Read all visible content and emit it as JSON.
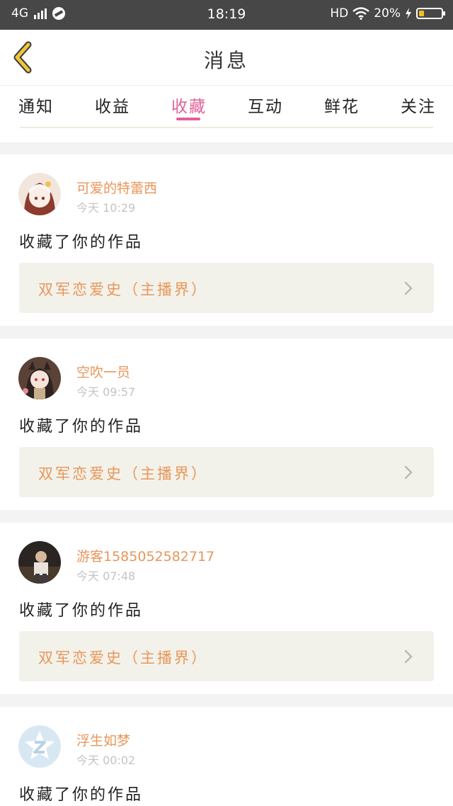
{
  "status_bar": {
    "network": "4G",
    "time": "18:19",
    "hd": "HD",
    "battery": "20%"
  },
  "header": {
    "title": "消息"
  },
  "tabs": [
    {
      "label": "通知",
      "active": false
    },
    {
      "label": "收益",
      "active": false
    },
    {
      "label": "收藏",
      "active": true
    },
    {
      "label": "互动",
      "active": false
    },
    {
      "label": "鲜花",
      "active": false
    },
    {
      "label": "关注",
      "active": false
    }
  ],
  "feed": [
    {
      "username": "可爱的特蕾西",
      "time": "今天 10:29",
      "action": "收藏了你的作品",
      "work": "双军恋爱史（主播界）"
    },
    {
      "username": "空吹一员",
      "time": "今天 09:57",
      "action": "收藏了你的作品",
      "work": "双军恋爱史（主播界）"
    },
    {
      "username": "游客1585052582717",
      "time": "今天 07:48",
      "action": "收藏了你的作品",
      "work": "双军恋爱史（主播界）"
    },
    {
      "username": "浮生如梦",
      "time": "今天 00:02",
      "action": "收藏了你的作品",
      "work": ""
    }
  ],
  "colors": {
    "accent": "#e0609a",
    "username": "#e8965a",
    "status_bar": "#474747",
    "back_arrow": "#f0c53a"
  }
}
